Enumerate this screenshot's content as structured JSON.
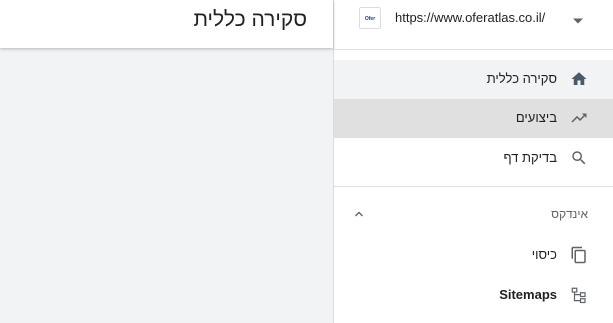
{
  "header": {
    "title": "סקירה כללית"
  },
  "property": {
    "url": "https://www.oferatlas.co.il/",
    "favicon_text": "Ofer Atlas",
    "dropdown_icon": "arrow-drop-down-icon"
  },
  "nav": {
    "items": [
      {
        "label": "סקירה כללית",
        "icon": "home-icon",
        "state": "hover"
      },
      {
        "label": "ביצועים",
        "icon": "trending-up-icon",
        "state": "active"
      },
      {
        "label": "בדיקת דף",
        "icon": "search-icon",
        "state": "normal"
      }
    ]
  },
  "index_section": {
    "title": "אינדקס",
    "collapse_icon": "chevron-up-icon",
    "items": [
      {
        "label": "כיסוי",
        "icon": "copy-icon"
      },
      {
        "label": "Sitemaps",
        "icon": "sitemap-icon"
      }
    ]
  },
  "colors": {
    "accent": "#5f6368",
    "active_bg": "#e0e0e0",
    "hover_bg": "#f1f3f4",
    "text": "#202124"
  }
}
